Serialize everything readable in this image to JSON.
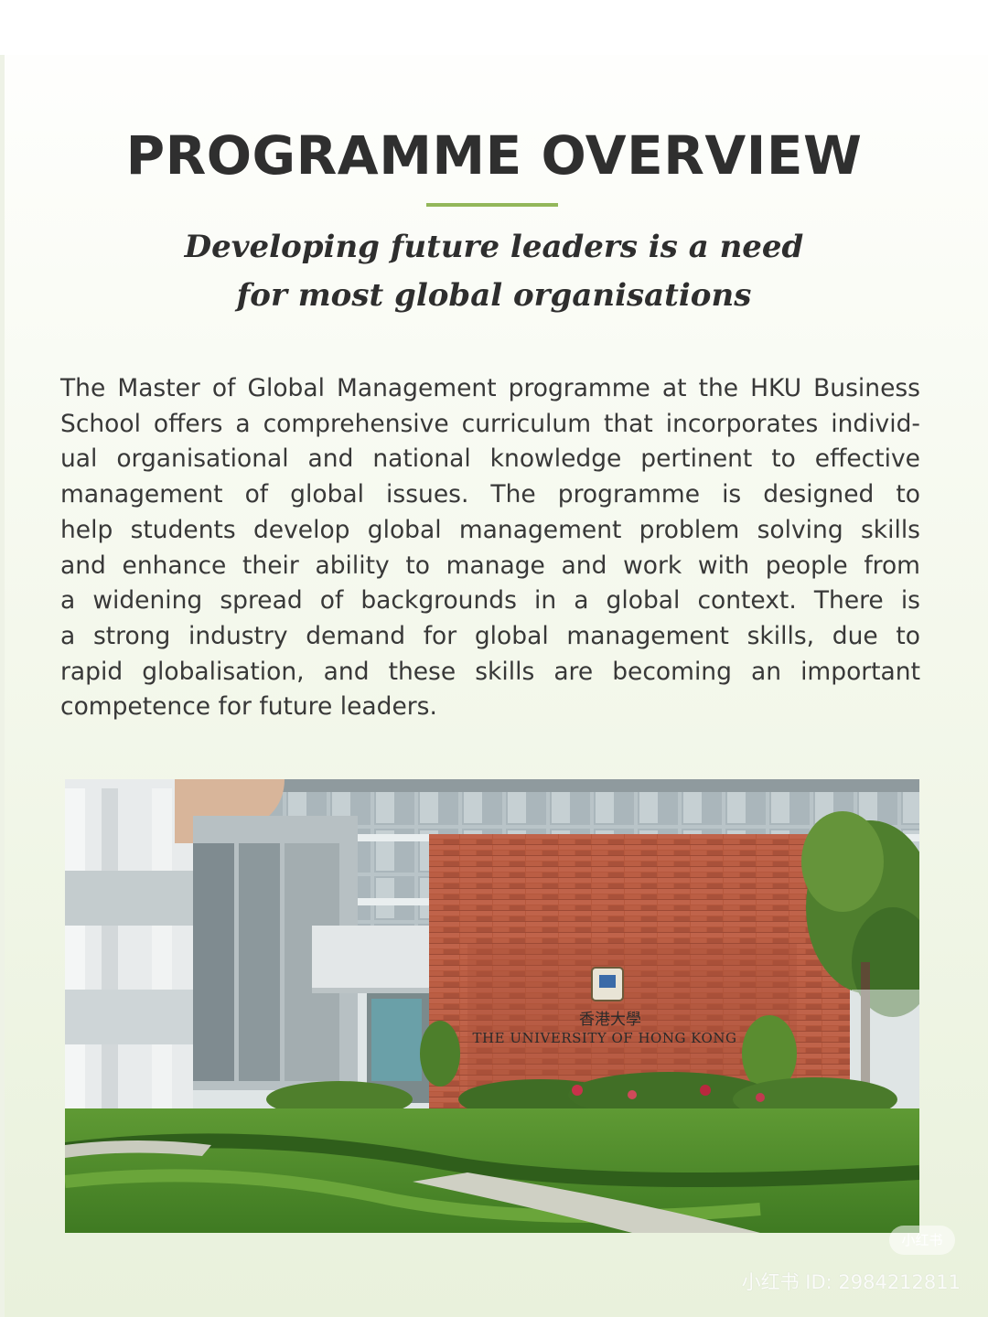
{
  "header": {
    "title": "PROGRAMME OVERVIEW",
    "subtitle_lines": [
      "Developing future leaders is a need",
      "for most global organisations"
    ]
  },
  "body": {
    "paragraph_lines": [
      "The Master of Global Management programme at the HKU Business",
      "School offers a comprehensive curriculum that incorporates individ-",
      "ual organisational and national knowledge pertinent to effective",
      "management of global issues. The programme is designed to",
      "help students develop global management problem solving skills",
      "and enhance their ability to manage and work with people from",
      "a widening spread of backgrounds in a global context. There is",
      "a strong industry demand for global management skills, due to",
      "rapid globalisation, and these skills are becoming an important",
      "competence for future leaders."
    ]
  },
  "photo": {
    "sign_chinese": "香港大學",
    "sign_english": "THE UNIVERSITY OF HONG KONG"
  },
  "watermark": {
    "badge": "小红书",
    "id_text": "小红书 ID: 2984212811"
  },
  "colors": {
    "accent": "#93b75a",
    "title": "#2f2f2f",
    "brick": "#b5593f"
  }
}
